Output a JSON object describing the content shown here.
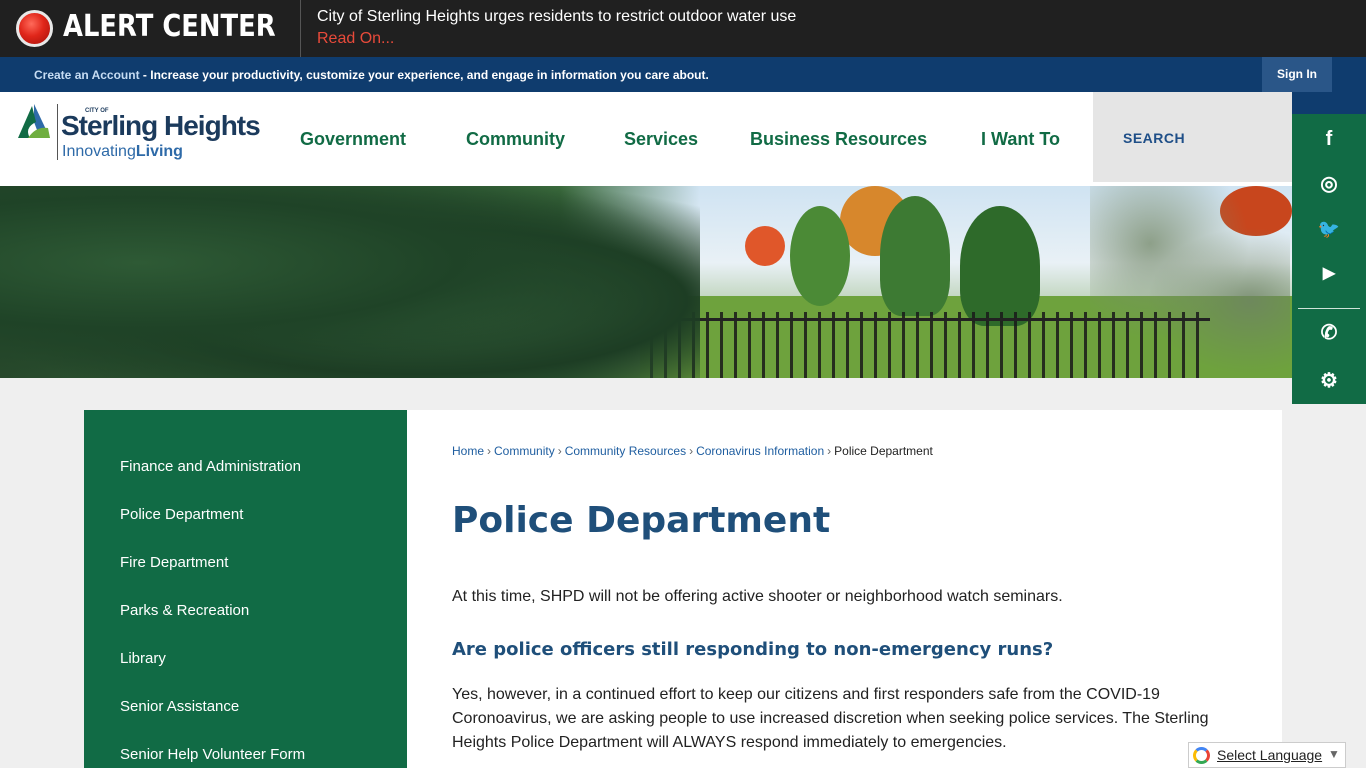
{
  "alert": {
    "title": "ALERT CENTER",
    "message": "City of Sterling Heights urges residents to restrict outdoor water use",
    "link": "Read On..."
  },
  "account": {
    "create_link": "Create an Account",
    "description": " - Increase your productivity, customize your experience, and engage in information you care about.",
    "sign_in": "Sign In"
  },
  "logo": {
    "city_of": "CITY OF",
    "name": "Sterling Heights",
    "tagline_a": "Innovating",
    "tagline_b": "Living"
  },
  "nav": [
    "Government",
    "Community",
    "Services",
    "Business Resources",
    "I Want To"
  ],
  "search": {
    "label": "SEARCH"
  },
  "social": {
    "icons": [
      "facebook-icon",
      "instagram-icon",
      "twitter-icon",
      "youtube-icon",
      "phone-icon",
      "gear-icon"
    ],
    "glyphs": [
      "f",
      "◎",
      "🐦",
      "▶",
      "✆",
      "⚙"
    ]
  },
  "sidebar": {
    "items": [
      "Finance and Administration",
      "Police Department",
      "Fire Department",
      "Parks & Recreation",
      "Library",
      "Senior Assistance",
      "Senior Help Volunteer Form"
    ]
  },
  "breadcrumb": {
    "links": [
      "Home",
      "Community",
      "Community Resources",
      "Coronavirus Information"
    ],
    "current": "Police Department",
    "separator": "›"
  },
  "content": {
    "title": "Police Department",
    "paragraph1": "At this time, SHPD will not be offering active shooter or neighborhood watch seminars.",
    "heading2": "Are police officers still responding to non-emergency runs?",
    "paragraph2": "Yes, however, in a continued effort to keep our citizens and first responders safe from the COVID-19 Coronoavirus, we are asking people to use increased discretion when seeking police services. The Sterling Heights Police Department will ALWAYS respond immediately to emergencies."
  },
  "language": {
    "label": "Select Language",
    "arrow": "▼"
  },
  "colors": {
    "primary_green": "#116b45",
    "navy": "#0f3c6e",
    "alert_red": "#e84a3a",
    "title_blue": "#1f4f7a"
  }
}
